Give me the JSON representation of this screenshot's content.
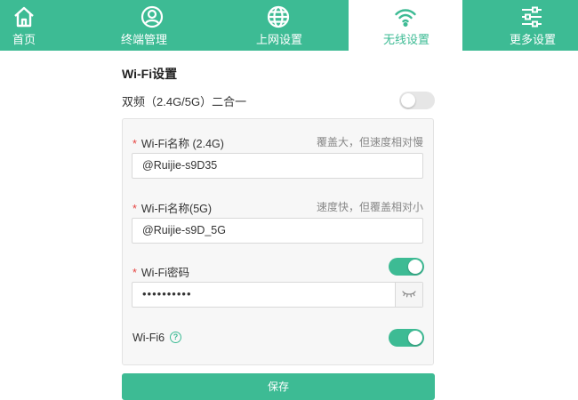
{
  "nav": {
    "tabs": [
      {
        "label": "首页",
        "icon": "home-icon"
      },
      {
        "label": "终端管理",
        "icon": "user-icon"
      },
      {
        "label": "上网设置",
        "icon": "globe-icon"
      },
      {
        "label": "无线设置",
        "icon": "wifi-icon",
        "active": true
      },
      {
        "label": "更多设置",
        "icon": "sliders-icon"
      }
    ]
  },
  "wifi": {
    "section_title": "Wi-Fi设置",
    "dual_band_label": "双频（2.4G/5G）二合一",
    "dual_band_enabled": false,
    "required_mark": "*",
    "ssid24_label": "Wi-Fi名称 (2.4G)",
    "ssid24_hint": "覆盖大，但速度相对慢",
    "ssid24_value": "@Ruijie-s9D35",
    "ssid5_label": "Wi-Fi名称(5G)",
    "ssid5_hint": "速度快，但覆盖相对小",
    "ssid5_value": "@Ruijie-s9D_5G",
    "password_label": "Wi-Fi密码",
    "password_enabled": true,
    "password_value": "••••••••••",
    "wifi6_label": "Wi-Fi6",
    "wifi6_enabled": true,
    "help_glyph": "?",
    "save_label": "保存"
  },
  "colors": {
    "accent": "#3dbb94",
    "required": "#e64340"
  }
}
